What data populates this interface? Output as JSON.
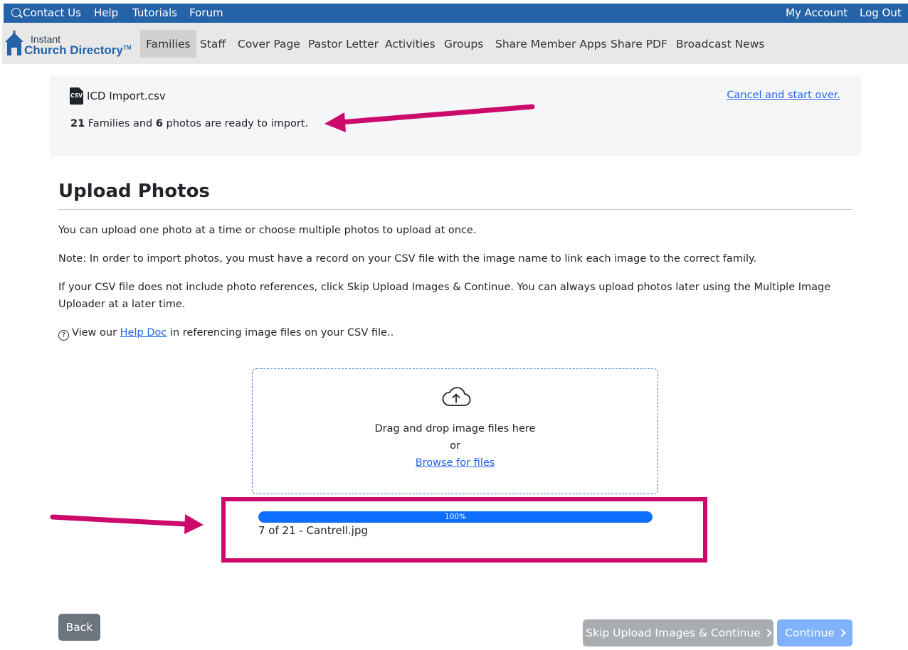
{
  "topbar": {
    "contact": "Contact Us",
    "help": "Help",
    "tutorials": "Tutorials",
    "forum": "Forum",
    "account": "My Account",
    "logout": "Log Out",
    "bg_color": "#2563a8"
  },
  "logo": {
    "line1": "Instant",
    "line2": "Church Directory",
    "tm": "TM"
  },
  "nav": {
    "items": [
      "Families",
      "Staff",
      "Cover Page",
      "Pastor Letter",
      "Activities",
      "Groups",
      "Share Member Apps",
      "Share PDF",
      "Broadcast News"
    ],
    "active": "Families"
  },
  "summary": {
    "file_icon_label": "CSV",
    "file_name": "ICD Import.csv",
    "families_count": "21",
    "families_text": "Families and",
    "photos_count": "6",
    "photos_text": "photos are ready to import.",
    "cancel": "Cancel and start over."
  },
  "upload": {
    "title": "Upload Photos",
    "p1": "You can upload one photo at a time or choose multiple photos to upload at once.",
    "p2": "Note: In order to import photos, you must have a record on your CSV file with the image name to link each image to the correct family.",
    "p3": "If your CSV file does not include photo references, click Skip Upload Images & Continue. You can always upload photos later using the Multiple Image Uploader at a later time.",
    "help_icon": "?",
    "help_pre": "View our",
    "help_link": "Help Doc",
    "help_post": "in referencing image files on your CSV file.."
  },
  "dropzone": {
    "icon": "cloud-upload-icon",
    "line1": "Drag and drop image files here",
    "line2": "or",
    "browse": "Browse for files"
  },
  "progress": {
    "percent": 100,
    "label": "100%",
    "caption": "7 of 21 - Cantrell.jpg",
    "color": "#0d6efd"
  },
  "buttons": {
    "back": "Back",
    "skip": "Skip Upload Images & Continue",
    "continue": "Continue"
  },
  "annotation_color": "#cc0a6c"
}
